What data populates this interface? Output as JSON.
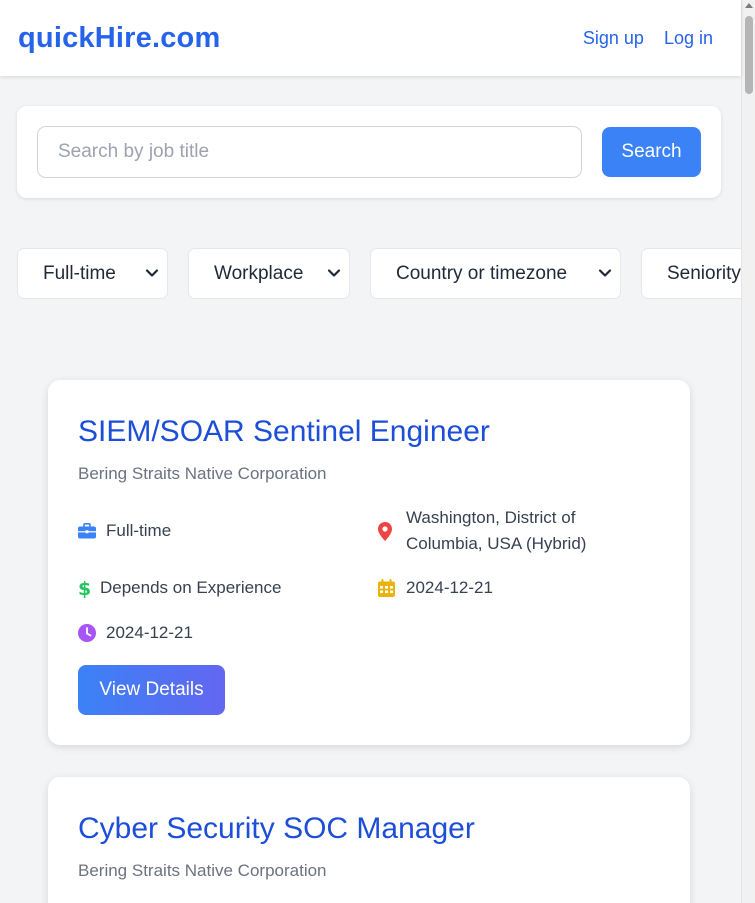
{
  "header": {
    "logo": "quickHire.com",
    "signup": "Sign up",
    "login": "Log in"
  },
  "search": {
    "placeholder": "Search by job title",
    "value": "",
    "button": "Search"
  },
  "filters": [
    {
      "label": "Full-time"
    },
    {
      "label": "Workplace"
    },
    {
      "label": "Country or timezone"
    },
    {
      "label": "Seniority"
    }
  ],
  "jobs": [
    {
      "title": "SIEM/SOAR Sentinel Engineer",
      "company": "Bering Straits Native Corporation",
      "type": "Full-time",
      "location_line1": "Washington, District of",
      "location_line2": "Columbia, USA (Hybrid)",
      "salary": "Depends on Experience",
      "date": "2024-12-21",
      "posted": "2024-12-21",
      "button": "View Details"
    },
    {
      "title": "Cyber Security SOC Manager",
      "company": "Bering Straits Native Corporation"
    }
  ],
  "colors": {
    "brand": "#2563eb",
    "button": "#3b82f6",
    "briefcase": "#3b82f6",
    "location": "#ef4444",
    "salary": "#22c55e",
    "calendar": "#eab308",
    "clock": "#a855f7"
  }
}
